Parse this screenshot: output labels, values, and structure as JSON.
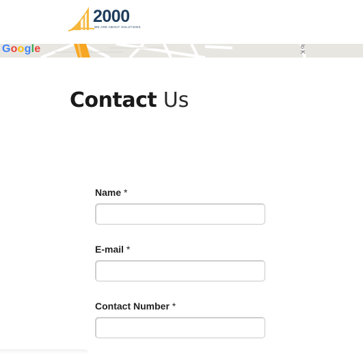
{
  "logo": {
    "number": "2000",
    "tagline": "WE ARE ABOUT SOLUTIONS",
    "colors": {
      "mark": "#f5b73c",
      "text": "#1f3d5c"
    }
  },
  "map": {
    "google_letters": [
      {
        "char": "G",
        "color": "#4285f4"
      },
      {
        "char": "o",
        "color": "#ea4335"
      },
      {
        "char": "o",
        "color": "#fbbc05"
      },
      {
        "char": "g",
        "color": "#4285f4"
      },
      {
        "char": "l",
        "color": "#34a853"
      },
      {
        "char": "e",
        "color": "#ea4335"
      }
    ],
    "road_label": "lo K",
    "colors": {
      "background": "#e8e6e1",
      "road": "#ffffff",
      "highway": "#f6a623"
    }
  },
  "page": {
    "title_bold": "Contact",
    "title_light": "Us"
  },
  "form": {
    "fields": [
      {
        "label": "Name",
        "required_mark": "*",
        "value": "",
        "placeholder": ""
      },
      {
        "label": "E-mail",
        "required_mark": "*",
        "value": "",
        "placeholder": ""
      },
      {
        "label": "Contact Number",
        "required_mark": "*",
        "value": "",
        "placeholder": ""
      }
    ]
  }
}
